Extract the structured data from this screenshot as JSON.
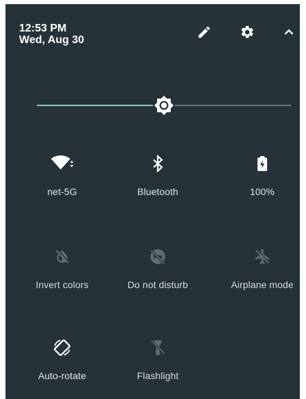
{
  "status": {
    "time": "12:53 PM",
    "date": "Wed, Aug 30"
  },
  "header": {
    "icons": [
      "edit-pencil-icon",
      "settings-gear-icon",
      "collapse-chevron-up-icon"
    ]
  },
  "brightness": {
    "level_percent": 50,
    "icon": "brightness-icon"
  },
  "tiles": [
    {
      "label": "net-5G",
      "icon": "wifi-icon",
      "active": true
    },
    {
      "label": "Bluetooth",
      "icon": "bluetooth-icon",
      "active": true
    },
    {
      "label": "100%",
      "icon": "battery-charging-icon",
      "active": true
    },
    {
      "label": "Invert colors",
      "icon": "invert-colors-icon",
      "active": false
    },
    {
      "label": "Do not disturb",
      "icon": "do-not-disturb-icon",
      "active": false
    },
    {
      "label": "Airplane mode",
      "icon": "airplane-icon",
      "active": false
    },
    {
      "label": "Auto-rotate",
      "icon": "auto-rotate-icon",
      "active": true
    },
    {
      "label": "Flashlight",
      "icon": "flashlight-icon",
      "active": false
    }
  ],
  "colors": {
    "panel_bg": "#263238",
    "accent": "#80cbc4",
    "icon_on": "#ffffff",
    "icon_off": "#5f6d73"
  }
}
